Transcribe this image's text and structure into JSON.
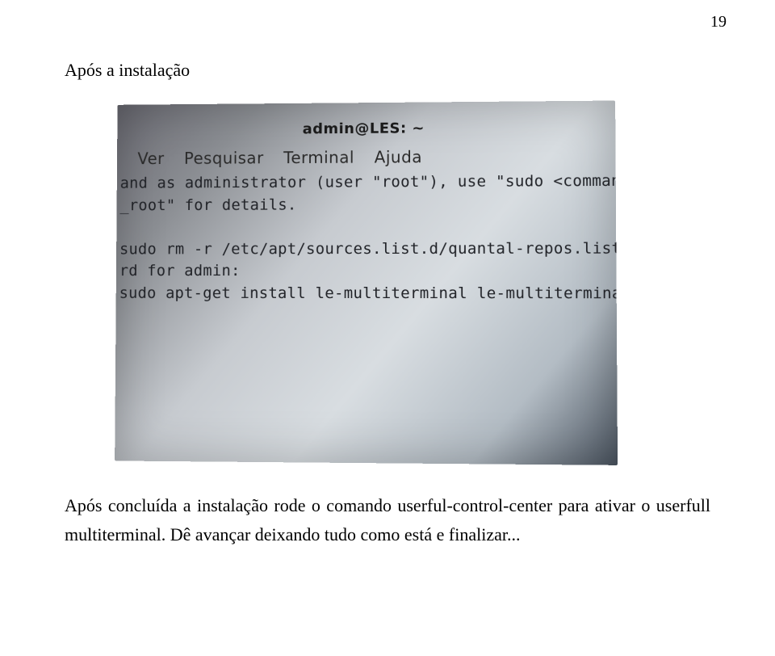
{
  "pageNumber": "19",
  "heading": "Após a instalação",
  "terminal": {
    "title": "admin@LES: ~",
    "menu": "Ver  Pesquisar  Terminal  Ajuda",
    "lines": [
      "and as administrator (user \"root\"), use \"sudo <command>\".",
      "_root\" for details.",
      "",
      "sudo rm -r /etc/apt/sources.list.d/quantal-repos.list",
      "rd for admin:",
      "sudo apt-get install le-multiterminal le-multiterminal-lic"
    ]
  },
  "paragraph": "Após concluída a instalação rode o comando userful-control-center para ativar o userfull multiterminal. Dê avançar deixando tudo como está e finalizar..."
}
